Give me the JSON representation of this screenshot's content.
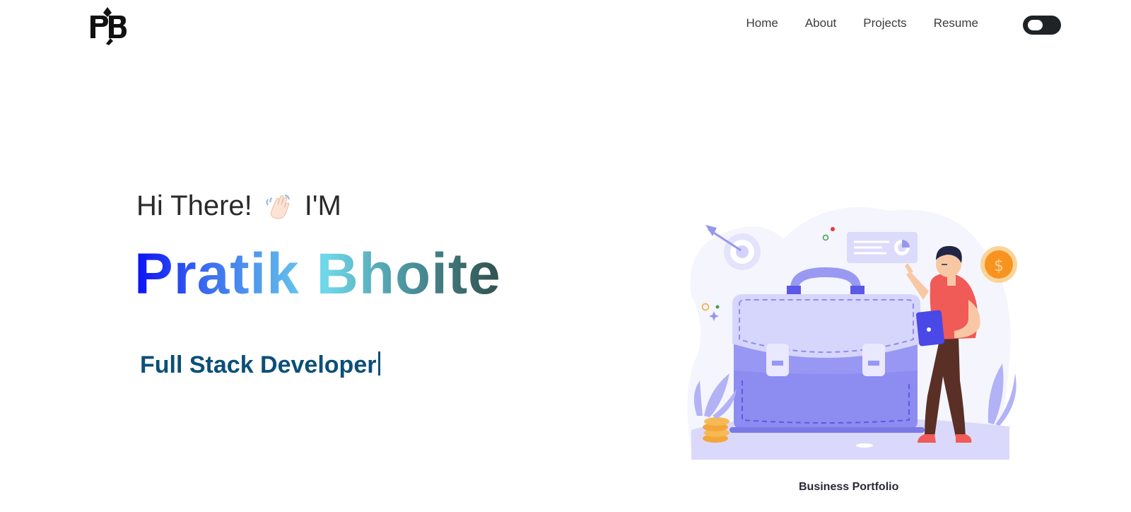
{
  "header": {
    "logo_text": "PB",
    "nav": [
      {
        "label": "Home"
      },
      {
        "label": "About"
      },
      {
        "label": "Projects"
      },
      {
        "label": "Resume"
      }
    ],
    "theme_toggle_icon": "toggle-switch-icon"
  },
  "hero": {
    "greeting": "Hi There!",
    "greeting_suffix": "I'M",
    "wave_icon": "waving-hand-icon",
    "name": "Pratik Bhoite",
    "role": "Full Stack Developer",
    "name_gradient": [
      "#0b10f5",
      "#3b6ef0",
      "#6fd9ea",
      "#4f9aa6",
      "#30504d"
    ],
    "role_color": "#0c4f78"
  },
  "illustration": {
    "caption": "Business Portfolio",
    "accent_colors": {
      "purple": "#8f8ef1",
      "light_purple": "#d6d5fb",
      "coral": "#f05a57",
      "gold": "#f4a63a"
    }
  }
}
